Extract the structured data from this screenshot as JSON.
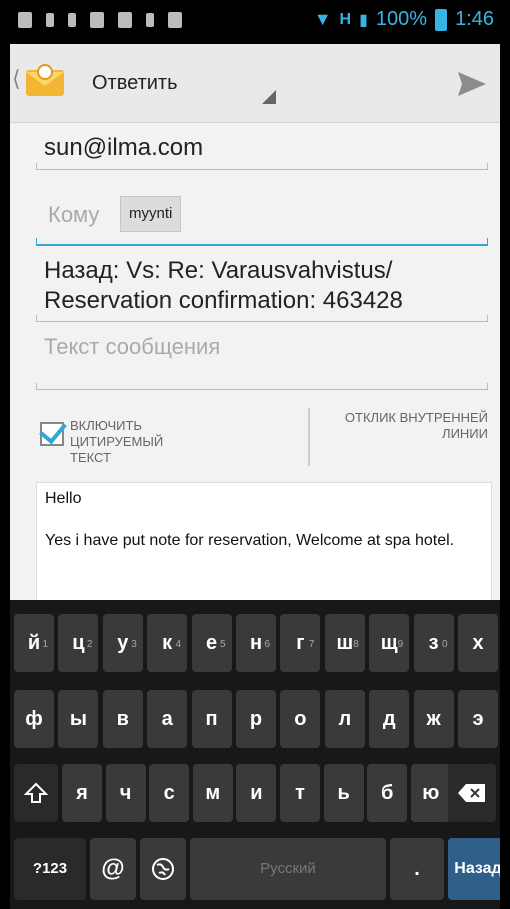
{
  "status_bar": {
    "battery_pct": "100%",
    "time": "1:46",
    "network": "H"
  },
  "action_bar": {
    "title": "Ответить",
    "icons": {
      "app": "email-app-icon",
      "send": "send-icon"
    }
  },
  "compose": {
    "from": "sun@ilma.com",
    "to_placeholder": "Кому",
    "to_chip": "myynti",
    "subject": "Назад: Vs: Re: Varausvahvistus/ Reservation confirmation: 463428",
    "body_placeholder": "Текст сообщения"
  },
  "options": {
    "include_quoted": "ВКЛЮЧИТЬ ЦИТИРУЕМЫЙ ТЕКСТ",
    "include_quoted_checked": true,
    "inline_reply": "ОТКЛИК ВНУТРЕННЕЙ ЛИНИИ"
  },
  "quoted": {
    "line1": "Hello",
    "line2": "Yes i have put note for reservation, Welcome at spa hotel."
  },
  "keyboard": {
    "row1": [
      "й",
      "ц",
      "у",
      "к",
      "е",
      "н",
      "г",
      "ш",
      "щ",
      "з",
      "х"
    ],
    "row1_sub": [
      "1",
      "2",
      "3",
      "4",
      "5",
      "6",
      "7",
      "8",
      "9",
      "0",
      ""
    ],
    "row2": [
      "ф",
      "ы",
      "в",
      "а",
      "п",
      "р",
      "о",
      "л",
      "д",
      "ж",
      "э"
    ],
    "row3": [
      "я",
      "ч",
      "с",
      "м",
      "и",
      "т",
      "ь",
      "б",
      "ю"
    ],
    "symbols": "?123",
    "at": "@",
    "space": "Русский",
    "period": ".",
    "enter": "Назад"
  },
  "colors": {
    "accent": "#33a7d8",
    "statusbar_icons": "#36b5e5"
  }
}
